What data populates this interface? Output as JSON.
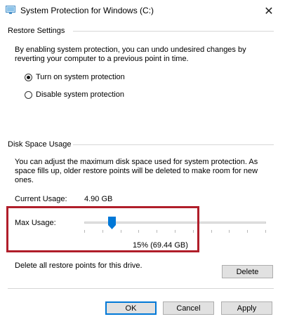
{
  "window": {
    "title": "System Protection for Windows (C:)",
    "close_icon": "close-icon"
  },
  "restore": {
    "heading": "Restore Settings",
    "description": "By enabling system protection, you can undo undesired changes by reverting your computer to a previous point in time.",
    "options": [
      {
        "label": "Turn on system protection",
        "selected": true
      },
      {
        "label": "Disable system protection",
        "selected": false
      }
    ]
  },
  "disk": {
    "heading": "Disk Space Usage",
    "description": "You can adjust the maximum disk space used for system protection. As space fills up, older restore points will be deleted to make room for new ones.",
    "current_usage_label": "Current Usage:",
    "current_usage_value": "4.90 GB",
    "max_usage_label": "Max Usage:",
    "max_usage_fraction": 0.15,
    "max_usage_value": "15% (69.44 GB)",
    "delete_text": "Delete all restore points for this drive.",
    "delete_button": "Delete"
  },
  "buttons": {
    "ok": "OK",
    "cancel": "Cancel",
    "apply": "Apply"
  },
  "colors": {
    "highlight": "#b01e2a",
    "accent": "#0078d7",
    "thumb": "#0078d7"
  }
}
